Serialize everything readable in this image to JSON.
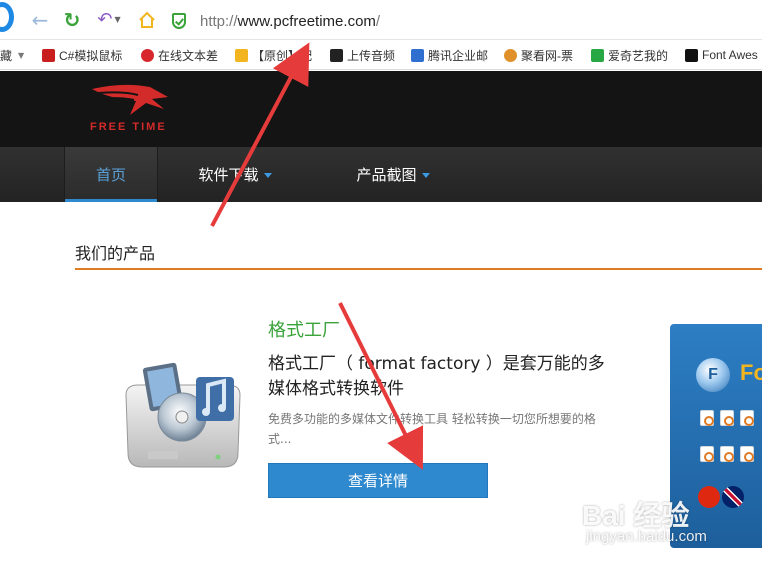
{
  "browser": {
    "url_prefix": "http://",
    "url_domain": "www.pcfreetime.com",
    "url_suffix": "/",
    "buttons": {
      "back_icon": "arrow-left-icon",
      "reload_icon": "reload-icon",
      "undo_icon": "undo-icon",
      "home_icon": "home-icon"
    },
    "bookmarks": [
      {
        "label": "藏",
        "icon": "",
        "color": ""
      },
      {
        "label": "C#模拟鼠标",
        "icon": "csdn-icon",
        "color": "#c81e1e"
      },
      {
        "label": "在线文本差",
        "icon": "q-icon",
        "color": "#d8262d"
      },
      {
        "label": "【原创】配",
        "icon": "b-icon",
        "color": "#f2b520"
      },
      {
        "label": "上传音频",
        "icon": "c-icon",
        "color": "#222222"
      },
      {
        "label": "腾讯企业邮",
        "icon": "mail-icon",
        "color": "#2f6fd0"
      },
      {
        "label": "聚看网-票",
        "icon": "ticket-icon",
        "color": "#e0902a"
      },
      {
        "label": "爱奇艺我的",
        "icon": "iqiyi-icon",
        "color": "#28a745"
      },
      {
        "label": "Font Awes",
        "icon": "flag-icon",
        "color": "#111111"
      }
    ]
  },
  "site": {
    "logo_text": "FREE TIME",
    "brand_color": "#d32a2a",
    "nav": [
      {
        "label": "首页",
        "active": true,
        "dropdown": false
      },
      {
        "label": "软件下载",
        "active": false,
        "dropdown": true
      },
      {
        "label": "产品截图",
        "active": false,
        "dropdown": true
      }
    ],
    "section_title": "我们的产品",
    "product": {
      "name": "格式工厂",
      "description": "格式工厂（ format factory ）是套万能的多媒体格式转换软件",
      "subtext": "免费多功能的多媒体文件转换工具 轻松转换一切您所想要的格式...",
      "button_label": "查看详情"
    },
    "side_banner_letter": "Fo"
  },
  "watermark": {
    "main": "Bai 经验",
    "sub": "jingyan.baidu.com"
  },
  "colors": {
    "accent_blue": "#2f89cf",
    "product_green": "#3aa33a",
    "rule_orange": "#e07b25",
    "arrow_red": "#e63b3b"
  }
}
